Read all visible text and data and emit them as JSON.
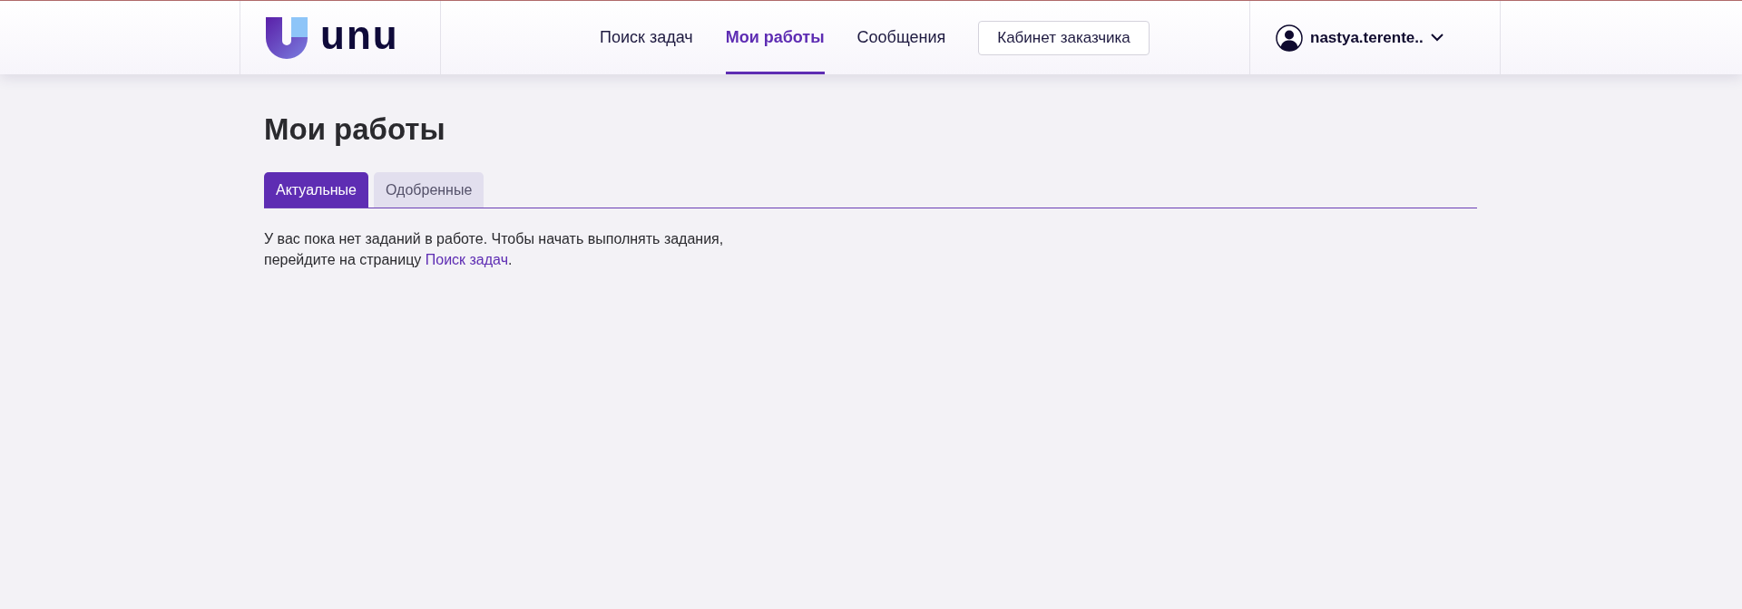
{
  "header": {
    "logo": {
      "text": "unu"
    },
    "nav": [
      {
        "label": "Поиск задач",
        "selected": false
      },
      {
        "label": "Мои работы",
        "selected": true
      },
      {
        "label": "Сообщения",
        "selected": false
      }
    ],
    "customer_button": "Кабинет заказчика",
    "user": {
      "name": "nastya.terente.."
    }
  },
  "page": {
    "title": "Мои работы",
    "tabs": [
      {
        "label": "Актуальные",
        "selected": true
      },
      {
        "label": "Одобренные",
        "selected": false
      }
    ],
    "message": {
      "line_1": "У вас пока нет заданий в работе. Чтобы начать выполнять задания,",
      "line_2": "перейдите на страницу ",
      "link": "Поиск задач",
      "end": "."
    }
  }
}
